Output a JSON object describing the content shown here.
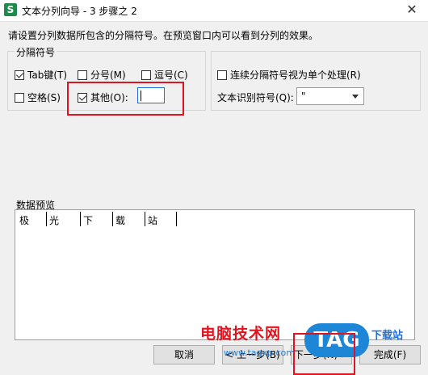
{
  "window": {
    "title": "文本分列向导 - 3 步骤之 2",
    "icon_letter": "S"
  },
  "instruction": "请设置分列数据所包含的分隔符号。在预览窗口内可以看到分列的效果。",
  "delimiters": {
    "legend": "分隔符号",
    "tab": {
      "label": "Tab键(T)",
      "checked": true
    },
    "semicolon": {
      "label": "分号(M)",
      "checked": false
    },
    "comma": {
      "label": "逗号(C)",
      "checked": false
    },
    "space": {
      "label": "空格(S)",
      "checked": false
    },
    "other": {
      "label": "其他(O):",
      "checked": true,
      "value": ""
    }
  },
  "options": {
    "consecutive": {
      "label": "连续分隔符号视为单个处理(R)",
      "checked": false
    },
    "qualifier_label": "文本识别符号(Q):",
    "qualifier_value": "\""
  },
  "preview": {
    "label": "数据预览",
    "columns": [
      "极",
      "光",
      "下",
      "载",
      "站"
    ]
  },
  "buttons": {
    "cancel": "取消",
    "back": "< 上一步(B)",
    "next": "下一步(N) >",
    "finish": "完成(F)"
  },
  "watermark": {
    "text": "电脑技术网",
    "url": "www.tagxp.com",
    "badge": "TAG",
    "side": "下载站"
  },
  "colors": {
    "highlight_red": "#e0141e",
    "input_focus": "#1e6fd9",
    "app_icon": "#1f8a4c"
  }
}
